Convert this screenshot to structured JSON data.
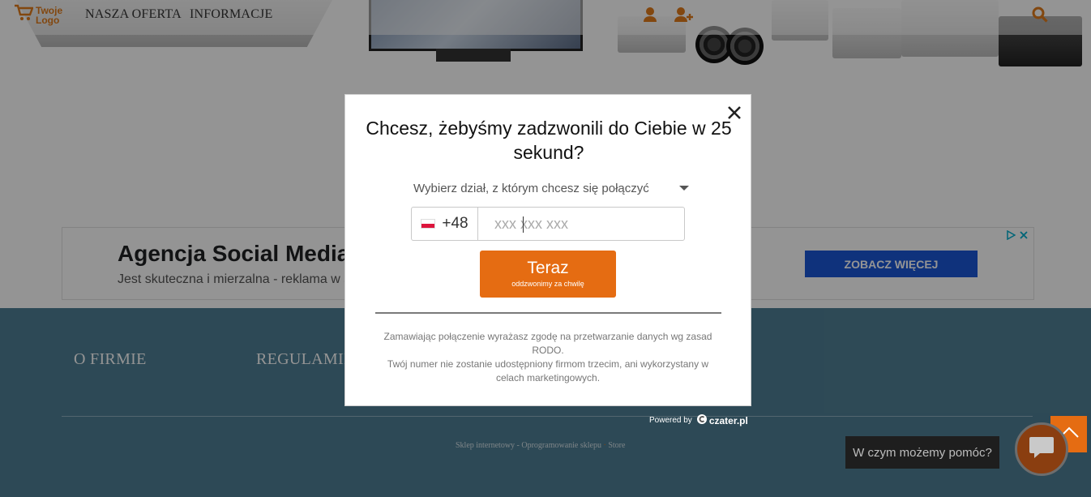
{
  "nav": {
    "logo_line1": "Twoje",
    "logo_line2": "Logo",
    "items": [
      "NASZA OFERTA",
      "INFORMACJE"
    ]
  },
  "ad": {
    "title": "Agencja Social Media",
    "subtitle": "Jest skuteczna i mierzalna - reklama w s",
    "button": "ZOBACZ WIĘCEJ"
  },
  "footer": {
    "links": [
      "O FIRMIE",
      "REGULAMIN"
    ],
    "credit_prefix": "Sklep internetowy - Oprogramowanie sklepu",
    "credit_suffix": "Store"
  },
  "modal": {
    "title": "Chcesz, żebyśmy zadzwonili do Ciebie w 25 sekund?",
    "department_placeholder": "Wybierz dział, z którym chcesz się połączyć",
    "phone_prefix": "+48",
    "phone_placeholder": "xxx xxx xxx",
    "call_button": "Teraz",
    "call_button_sub": "oddzwonimy za chwilę",
    "consent_line1": "Zamawiając połączenie wyrażasz zgodę na przetwarzanie danych wg zasad RODO.",
    "consent_line2": "Twój numer nie zostanie udostępniony firmom trzecim, ani wykorzystany w celach marketingowych."
  },
  "powered": {
    "label": "Powered by",
    "brand": "czater.pl"
  },
  "chat": {
    "tooltip": "W czym możemy pomóc?"
  },
  "colors": {
    "accent": "#e56c12",
    "footer_bg": "#4f7f95",
    "ad_button": "#1a56d6"
  },
  "icons": [
    "cart-icon",
    "user-icon",
    "add-user-icon",
    "search-icon",
    "close-icon",
    "chevron-down-icon",
    "chat-icon",
    "arrow-up-icon",
    "adchoices-icon"
  ]
}
